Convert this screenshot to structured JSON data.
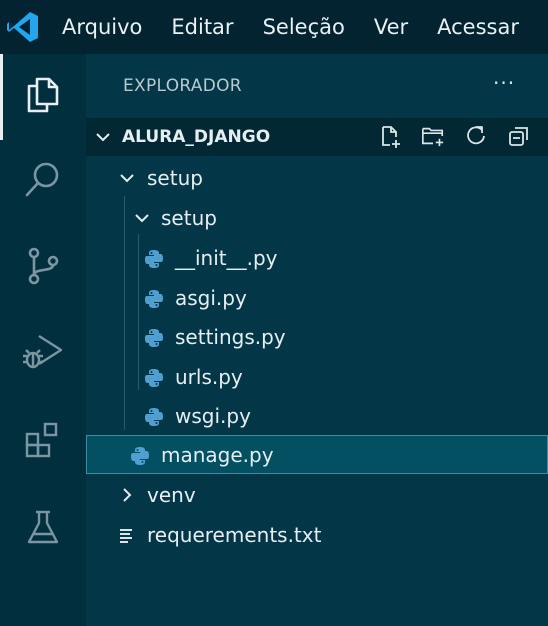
{
  "menu": {
    "items": [
      "Arquivo",
      "Editar",
      "Seleção",
      "Ver",
      "Acessar"
    ]
  },
  "activity_bar": {
    "items": [
      "explorer-icon",
      "search-icon",
      "source-control-icon",
      "run-debug-icon",
      "extensions-icon",
      "testing-icon"
    ]
  },
  "explorer": {
    "title": "EXPLORADOR",
    "more": "···",
    "section_title": "ALURA_DJANGO",
    "tree": {
      "setup": "setup",
      "setup_inner": "setup",
      "init": "__init__.py",
      "asgi": "asgi.py",
      "settings": "settings.py",
      "urls": "urls.py",
      "wsgi": "wsgi.py",
      "manage": "manage.py",
      "venv": "venv",
      "requirements": "requerements.txt"
    }
  },
  "colors": {
    "accent": "#23a6f0",
    "python_icon": "#4f9fd1",
    "selection": "#045063"
  }
}
